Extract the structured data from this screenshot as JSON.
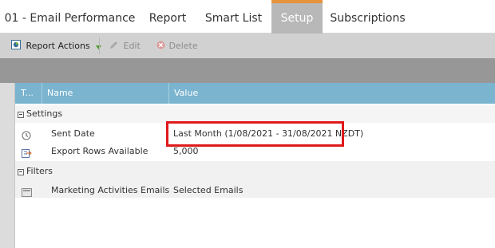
{
  "tabs": [
    {
      "label": "01 - Email Performance",
      "active": false
    },
    {
      "label": "Report",
      "active": false
    },
    {
      "label": "Smart List",
      "active": false
    },
    {
      "label": "Setup",
      "active": true
    },
    {
      "label": "Subscriptions",
      "active": false
    }
  ],
  "toolbar": {
    "report_actions": "Report Actions",
    "edit": "Edit",
    "delete": "Delete"
  },
  "grid": {
    "columns": [
      "T...",
      "Name",
      "Value"
    ],
    "groups": [
      {
        "label": "Settings",
        "rows": [
          {
            "icon": "clock-icon",
            "name": "Sent Date",
            "value": "Last Month (1/08/2021 - 31/08/2021 NZDT)"
          },
          {
            "icon": "export-icon",
            "name": "Export Rows Available",
            "value": "5,000"
          }
        ]
      },
      {
        "label": "Filters",
        "rows": [
          {
            "icon": "email-icon",
            "name": "Marketing Activities Emails",
            "value": "Selected Emails"
          }
        ]
      }
    ]
  },
  "colors": {
    "active_tab_accent": "#e8923c",
    "header_blue": "#7ab4cf",
    "highlight_red": "#e01a1a"
  }
}
